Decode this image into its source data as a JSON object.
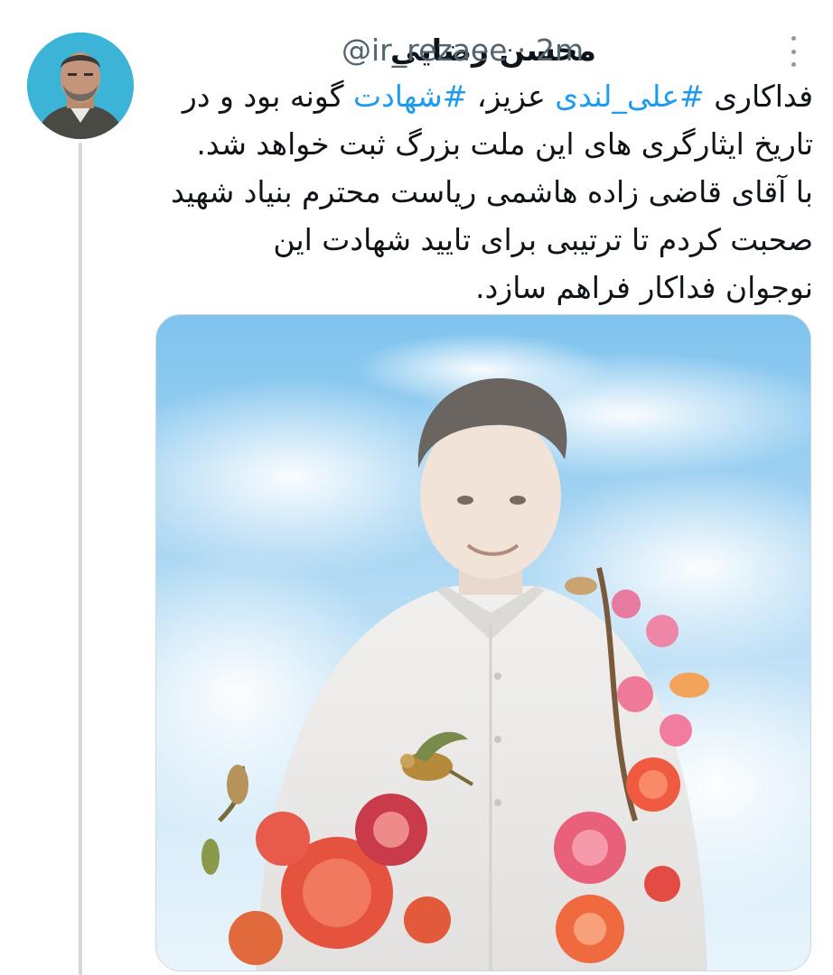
{
  "tweet": {
    "author": {
      "name": "محسن رضایی",
      "handle": "@ir_rezaee",
      "separator": "·",
      "time": "2m"
    },
    "text": {
      "line1_prefix": "فداکاری ",
      "hashtag1": "#علی_لندی",
      "line1_mid": " عزیز، ",
      "hashtag2": "#شهادت",
      "line1_suffix": " گونه بود و در",
      "line2": "تاریخ ایثارگری های این ملت بزرگ ثبت خواهد شد.",
      "line3": "با آقای قاضی زاده هاشمی ریاست محترم بنیاد شهید",
      "line4": "صحبت کردم تا ترتیبی برای تایید شهادت این",
      "line5": "نوجوان فداکار فراهم سازد."
    },
    "colors": {
      "hashtag": "#1d9bf0",
      "text": "#0f1419",
      "meta": "#536471"
    },
    "icons": [
      "more-options-icon"
    ]
  }
}
